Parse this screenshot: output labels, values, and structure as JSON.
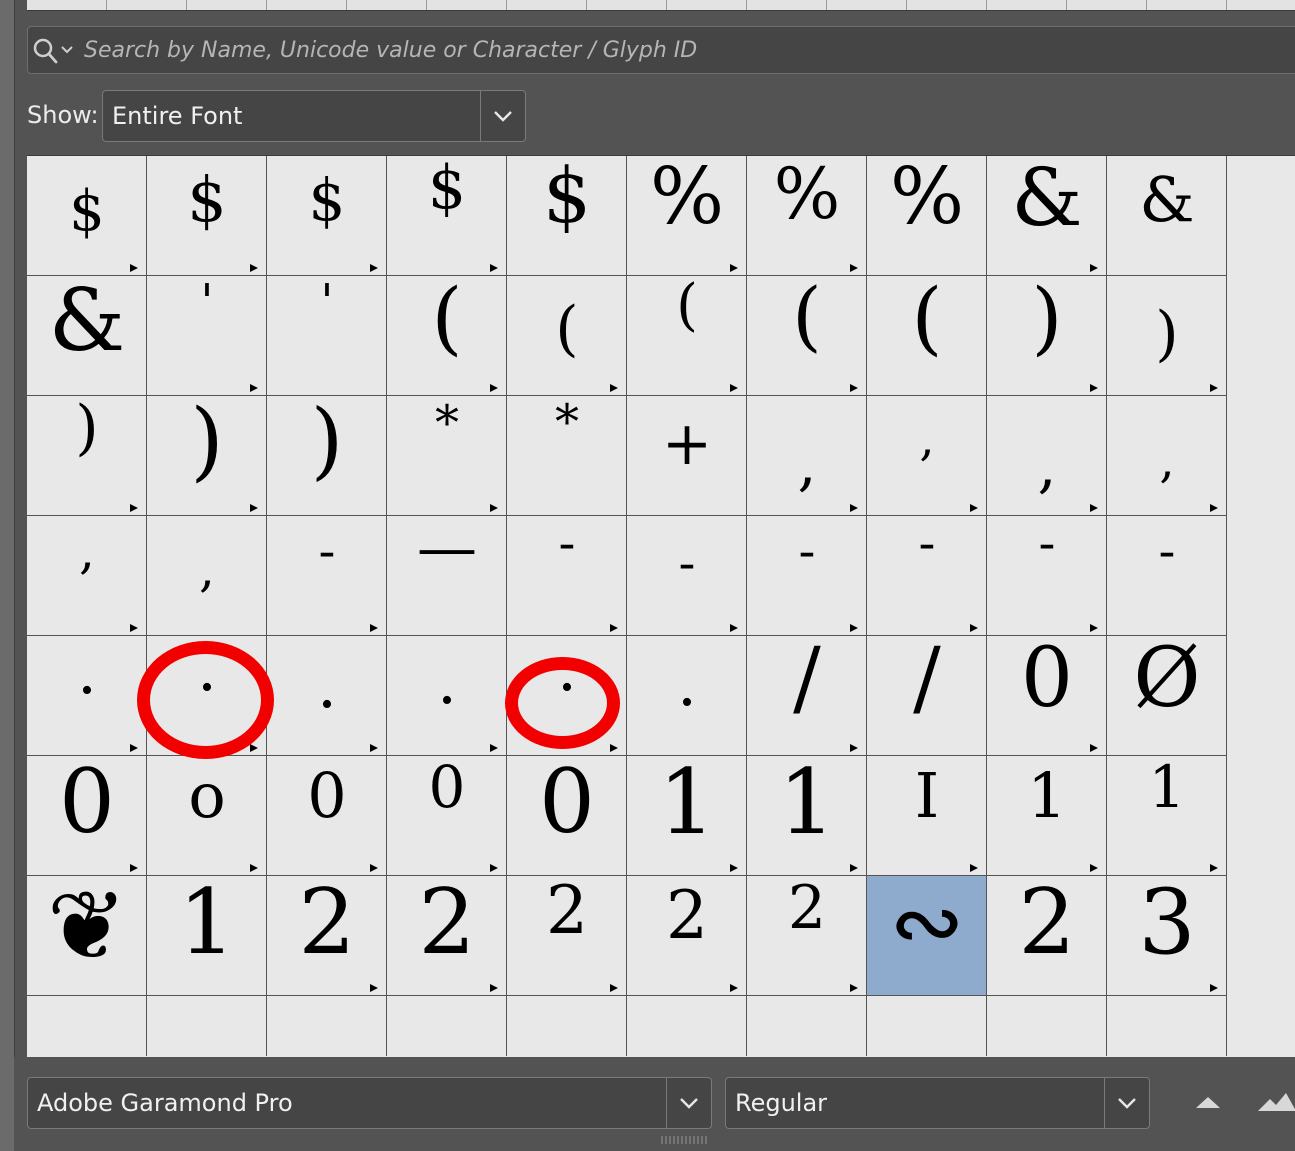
{
  "search": {
    "placeholder": "Search by Name, Unicode value or Character / Glyph ID"
  },
  "show": {
    "label": "Show:",
    "value": "Entire Font"
  },
  "glyph_rows": [
    [
      {
        "char": "$",
        "alt": true
      },
      {
        "char": "$",
        "alt": true
      },
      {
        "char": "$",
        "alt": true
      },
      {
        "char": "$",
        "alt": true
      },
      {
        "char": "$",
        "alt": false
      },
      {
        "char": "%",
        "alt": true
      },
      {
        "char": "%",
        "alt": true
      },
      {
        "char": "%",
        "alt": false
      },
      {
        "char": "&",
        "alt": true
      },
      {
        "char": "&",
        "alt": false
      }
    ],
    [
      {
        "char": "&",
        "alt": false
      },
      {
        "char": "'",
        "alt": true
      },
      {
        "char": "'",
        "alt": false
      },
      {
        "char": "(",
        "alt": true
      },
      {
        "char": "(",
        "alt": true
      },
      {
        "char": "(",
        "alt": true
      },
      {
        "char": "(",
        "alt": true
      },
      {
        "char": "(",
        "alt": false
      },
      {
        "char": ")",
        "alt": true
      },
      {
        "char": ")",
        "alt": true
      }
    ],
    [
      {
        "char": ")",
        "alt": true
      },
      {
        "char": ")",
        "alt": true
      },
      {
        "char": ")",
        "alt": false
      },
      {
        "char": "*",
        "alt": true
      },
      {
        "char": "*",
        "alt": false
      },
      {
        "char": "+",
        "alt": false
      },
      {
        "char": ",",
        "alt": true
      },
      {
        "char": ",",
        "alt": true
      },
      {
        "char": ",",
        "alt": true
      },
      {
        "char": ",",
        "alt": true
      }
    ],
    [
      {
        "char": ",",
        "alt": true
      },
      {
        "char": ",",
        "alt": false
      },
      {
        "char": "-",
        "alt": true
      },
      {
        "char": "—",
        "alt": false
      },
      {
        "char": "-",
        "alt": true
      },
      {
        "char": "-",
        "alt": true
      },
      {
        "char": "-",
        "alt": true
      },
      {
        "char": "-",
        "alt": true
      },
      {
        "char": "-",
        "alt": true
      },
      {
        "char": "-",
        "alt": false
      }
    ],
    [
      {
        "char": ".",
        "alt": true
      },
      {
        "char": ".",
        "alt": true
      },
      {
        "char": ".",
        "alt": true
      },
      {
        "char": ".",
        "alt": true
      },
      {
        "char": ".",
        "alt": true
      },
      {
        "char": ".",
        "alt": false
      },
      {
        "char": "/",
        "alt": true
      },
      {
        "char": "/",
        "alt": false
      },
      {
        "char": "0",
        "alt": true
      },
      {
        "char": "Ø",
        "alt": false
      }
    ],
    [
      {
        "char": "0",
        "alt": true
      },
      {
        "char": "o",
        "alt": true
      },
      {
        "char": "0",
        "alt": true
      },
      {
        "char": "0",
        "alt": true
      },
      {
        "char": "0",
        "alt": false
      },
      {
        "char": "1",
        "alt": true
      },
      {
        "char": "1",
        "alt": true
      },
      {
        "char": "I",
        "alt": true
      },
      {
        "char": "1",
        "alt": true
      },
      {
        "char": "1",
        "alt": true
      }
    ],
    [
      {
        "char": "❦",
        "alt": false
      },
      {
        "char": "1",
        "alt": false
      },
      {
        "char": "2",
        "alt": true
      },
      {
        "char": "2",
        "alt": true
      },
      {
        "char": "2",
        "alt": true
      },
      {
        "char": "2",
        "alt": true
      },
      {
        "char": "2",
        "alt": true
      },
      {
        "char": "∾",
        "alt": false,
        "selected": true
      },
      {
        "char": "2",
        "alt": false
      },
      {
        "char": "3",
        "alt": true
      }
    ]
  ],
  "font_family": "Adobe Garamond Pro",
  "font_style": "Regular",
  "colors": {
    "selection": "#8eaacd",
    "annotation": "#f20000",
    "panel": "#535353"
  },
  "icons": {
    "search": "search-icon",
    "dropdown": "chevron-down-icon",
    "zoom_out": "zoom-out-mountain-icon",
    "zoom_in": "zoom-in-mountain-icon"
  }
}
